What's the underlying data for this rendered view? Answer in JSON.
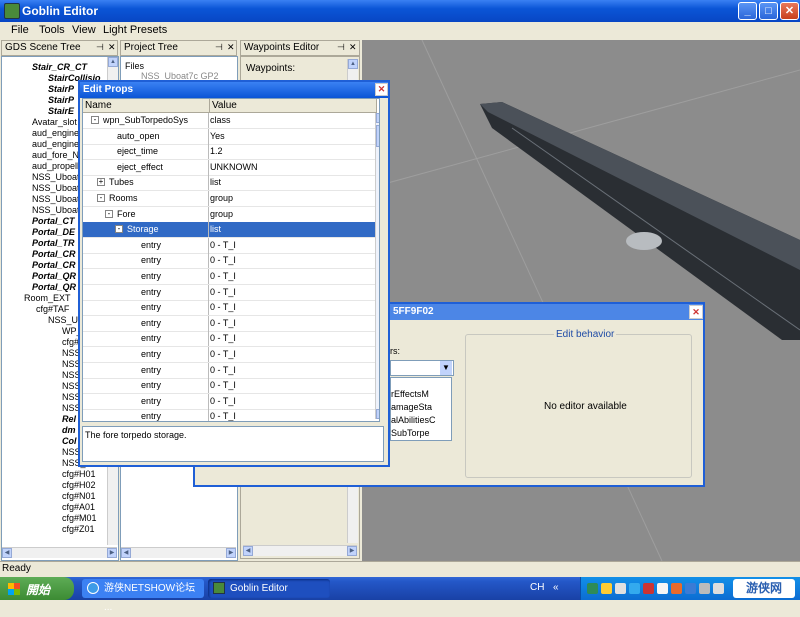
{
  "window": {
    "title": "Goblin Editor",
    "min": "_",
    "max": "□",
    "close": "✕"
  },
  "menu": [
    "File",
    "Tools",
    "View",
    "Light Presets"
  ],
  "panels": {
    "scene_tree": {
      "title": "GDS Scene Tree"
    },
    "project_tree": {
      "title": "Project Tree",
      "items": [
        "Files",
        "NSS_Uboat7c GP2"
      ]
    },
    "waypoints": {
      "title": "Waypoints Editor",
      "label": "Waypoints:"
    }
  },
  "scene_tree_items": [
    {
      "label": "Stair_CR_CT",
      "style": "bi"
    },
    {
      "label": "StairCollisio",
      "style": "bi"
    },
    {
      "label": "StairP",
      "style": "bi"
    },
    {
      "label": "StairP",
      "style": "bi"
    },
    {
      "label": "StairE",
      "style": "bi"
    },
    {
      "label": "Avatar_slot",
      "style": ""
    },
    {
      "label": "aud_engine",
      "style": ""
    },
    {
      "label": "aud_engine",
      "style": ""
    },
    {
      "label": "aud_fore_N",
      "style": ""
    },
    {
      "label": "aud_propell",
      "style": ""
    },
    {
      "label": "NSS_Uboat",
      "style": ""
    },
    {
      "label": "NSS_Uboat",
      "style": ""
    },
    {
      "label": "NSS_Uboat",
      "style": ""
    },
    {
      "label": "NSS_Uboat",
      "style": ""
    },
    {
      "label": "Portal_CT",
      "style": "bi"
    },
    {
      "label": "Portal_DE",
      "style": "bi"
    },
    {
      "label": "Portal_TR",
      "style": "bi"
    },
    {
      "label": "Portal_CR",
      "style": "bi"
    },
    {
      "label": "Portal_CR",
      "style": "bi"
    },
    {
      "label": "Portal_QR",
      "style": "bi"
    },
    {
      "label": "Portal_QR",
      "style": "bi"
    },
    {
      "label": "Room_EXT",
      "style": ""
    },
    {
      "label": "cfg#TAF",
      "style": ""
    },
    {
      "label": "NSS_Ub",
      "style": ""
    },
    {
      "label": "WP_",
      "style": ""
    },
    {
      "label": "cfg#",
      "style": ""
    },
    {
      "label": "NSS",
      "style": ""
    },
    {
      "label": "NSS",
      "style": ""
    },
    {
      "label": "NSS",
      "style": ""
    },
    {
      "label": "NSS",
      "style": ""
    },
    {
      "label": "NSS",
      "style": ""
    },
    {
      "label": "NSS",
      "style": ""
    },
    {
      "label": "Rel",
      "style": "bi"
    },
    {
      "label": "dm",
      "style": "bi"
    },
    {
      "label": "Col",
      "style": "bi"
    },
    {
      "label": "NSS_",
      "style": ""
    },
    {
      "label": "NSS_Uboa",
      "style": ""
    },
    {
      "label": "cfg#H01",
      "style": ""
    },
    {
      "label": "cfg#H02",
      "style": ""
    },
    {
      "label": "cfg#N01",
      "style": ""
    },
    {
      "label": "cfg#A01",
      "style": ""
    },
    {
      "label": "cfg#M01",
      "style": ""
    },
    {
      "label": "cfg#Z01",
      "style": ""
    }
  ],
  "edit_props": {
    "title": "Edit Props",
    "col_name": "Name",
    "col_value": "Value",
    "rows": [
      {
        "name": "wpn_SubTorpedoSys",
        "value": "class",
        "exp": "-"
      },
      {
        "name": "auto_open",
        "value": "Yes"
      },
      {
        "name": "eject_time",
        "value": "1.2"
      },
      {
        "name": "eject_effect",
        "value": "UNKNOWN"
      },
      {
        "name": "Tubes",
        "value": "list",
        "exp": "+"
      },
      {
        "name": "Rooms",
        "value": "group",
        "exp": "-"
      },
      {
        "name": "Fore",
        "value": "group",
        "exp": "-"
      },
      {
        "name": "Storage",
        "value": "list",
        "exp": "-",
        "selected": true
      },
      {
        "name": "entry",
        "value": "0 - T_I"
      },
      {
        "name": "entry",
        "value": "0 - T_I"
      },
      {
        "name": "entry",
        "value": "0 - T_I"
      },
      {
        "name": "entry",
        "value": "0 - T_I"
      },
      {
        "name": "entry",
        "value": "0 - T_I"
      },
      {
        "name": "entry",
        "value": "0 - T_I"
      },
      {
        "name": "entry",
        "value": "0 - T_I"
      },
      {
        "name": "entry",
        "value": "0 - T_I"
      },
      {
        "name": "entry",
        "value": "0 - T_I"
      },
      {
        "name": "entry",
        "value": "0 - T_I"
      },
      {
        "name": "entry",
        "value": "0 - T_I"
      },
      {
        "name": "entry",
        "value": "0 - T_I"
      },
      {
        "name": "entry",
        "value": "0 - T_I"
      }
    ],
    "description": "The fore torpedo storage."
  },
  "behavior_dialog": {
    "title_fragment": "5FF9F02",
    "label_fragment": "ors:",
    "list_items": [
      "rEffectsM",
      "amageSta",
      "alAbilitiesC",
      "SubTorpe"
    ],
    "group_title": "Edit behavior",
    "no_editor": "No editor available"
  },
  "status": "Ready",
  "taskbar": {
    "start": "開始",
    "tasks": [
      "游侠NETSHOW论坛 ...",
      "Goblin Editor"
    ],
    "lang": "CH",
    "watermark": "游侠网"
  }
}
